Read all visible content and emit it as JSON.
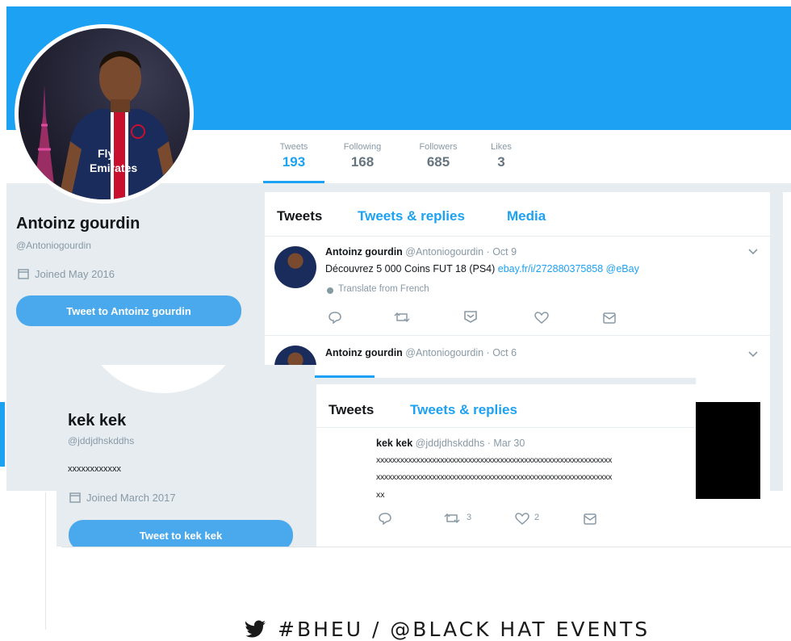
{
  "profile1": {
    "name": "Antoinz gourdin",
    "handle": "@Antoniogourdin",
    "joined": "Joined May 2016",
    "tweet_to": "Tweet to Antoinz gourdin",
    "stats": [
      {
        "label": "Tweets",
        "value": "193"
      },
      {
        "label": "Following",
        "value": "168"
      },
      {
        "label": "Followers",
        "value": "685"
      },
      {
        "label": "Likes",
        "value": "3"
      }
    ],
    "tabs": [
      "Tweets",
      "Tweets & replies",
      "Media"
    ],
    "tweets": [
      {
        "author": "Antoinz gourdin",
        "meta": "@Antoniogourdin · Oct 9",
        "text": "Découvrez 5 000  Coins FUT 18 (PS4)",
        "link": "ebay.fr/i/272880375858 @eBay",
        "translate": "Translate from French"
      },
      {
        "author": "Antoinz gourdin",
        "meta": "@Antoniogourdin · Oct 6"
      }
    ]
  },
  "profile2": {
    "name": "kek kek",
    "handle": "@jddjdhskddhs",
    "bio": "xxxxxxxxxxxx",
    "joined": "Joined March 2017",
    "tweet_to": "Tweet to kek kek",
    "tabs": [
      "Tweets",
      "Tweets & replies"
    ],
    "tweet": {
      "author": "kek kek",
      "meta": "@jddjdhskddhs · Mar 30",
      "line1": "xxxxxxxxxxxxxxxxxxxxxxxxxxxxxxxxxxxxxxxxxxxxxxxxxxxxxxxxxxx",
      "line2": "xxxxxxxxxxxxxxxxxxxxxxxxxxxxxxxxxxxxxxxxxxxxxxxxxxxxxxxxxxx",
      "line3": "xx",
      "retweets": "3",
      "likes": "2"
    }
  },
  "banner": {
    "text": "#BHEU / @BLACK HAT EVENTS"
  },
  "colors": {
    "twitter_blue": "#1da1f2",
    "header_blue": "#1da1f2",
    "button_blue": "#4aa8ec",
    "page_bg": "#e6ecf0",
    "text_dark": "#14171a",
    "text_grey": "#8899a6"
  }
}
